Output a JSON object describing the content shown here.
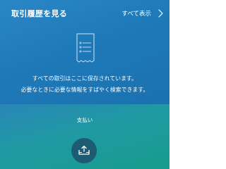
{
  "header": {
    "title": "取引履歴を見る",
    "view_all_label": "すべて表示"
  },
  "empty_state": {
    "icon": "receipt-icon",
    "line1": "すべての取引はここに保存されています。",
    "line2": "必要なときに必要な情報をすばやく検索できます。"
  },
  "payment": {
    "label": "支払い",
    "icon": "payment-upload-icon"
  },
  "colors": {
    "top_panel": "#1e79b8",
    "bottom_panel_end": "#169c8c",
    "button": "#1d5b73",
    "text": "#ffffff"
  }
}
